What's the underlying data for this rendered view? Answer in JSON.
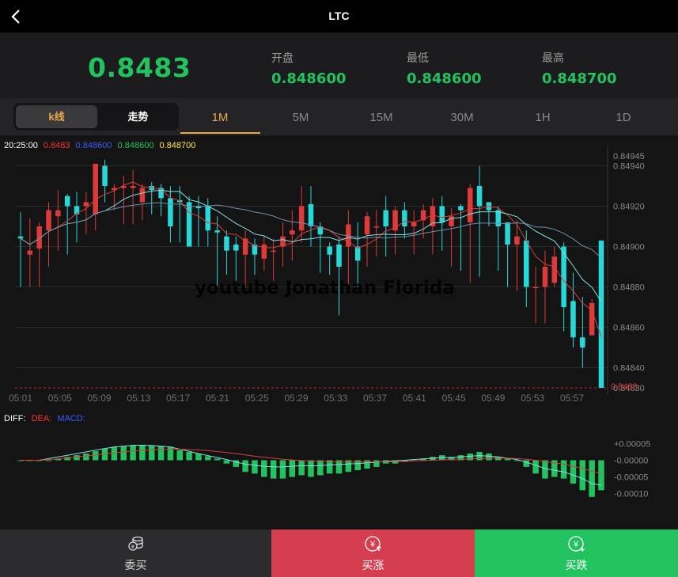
{
  "header": {
    "title": "LTC"
  },
  "quote": {
    "price": "0.8483",
    "open_label": "开盘",
    "open_value": "0.848600",
    "low_label": "最低",
    "low_value": "0.848600",
    "high_label": "最高",
    "high_value": "0.848700"
  },
  "toggle": {
    "kline": "k线",
    "trend": "走势"
  },
  "timeframes": [
    "1M",
    "5M",
    "15M",
    "30M",
    "1H",
    "1D"
  ],
  "active_timeframe": "1M",
  "ma_line": {
    "time": "20:25:00",
    "v1": "0.8483",
    "v2": "0.848600",
    "v3": "0.848600",
    "v4": "0.848700"
  },
  "watermark": "youtube Jonathan Florida",
  "macd_labels": {
    "diff": "DIFF:",
    "dea": "DEA:",
    "macd": "MACD:"
  },
  "colors": {
    "up": "#dd3b3b",
    "down": "#26d8d8",
    "green": "#22c35e",
    "accent": "#e8a94a"
  },
  "buttons": {
    "entrust": "委买",
    "buy_up": "买涨",
    "buy_down": "买跌"
  },
  "chart_data": [
    {
      "type": "candlestick",
      "y_ticks": [
        "0.84945",
        "0.84940",
        "0.84920",
        "0.84900",
        "0.84880",
        "0.84860",
        "0.84840",
        "0.84830"
      ],
      "ylim": [
        0.8483,
        0.8495
      ],
      "current_label": "0.8483",
      "x_ticks": [
        "05:01",
        "05:05",
        "05:09",
        "05:13",
        "05:17",
        "05:21",
        "05:25",
        "05:29",
        "05:33",
        "05:37",
        "05:41",
        "05:45",
        "05:49",
        "05:53",
        "05:57"
      ],
      "candles": [
        [
          0.84905,
          0.84904,
          0.84917,
          0.8488
        ],
        [
          0.84896,
          0.84898,
          0.84914,
          0.8488
        ],
        [
          0.84899,
          0.8491,
          0.84912,
          0.8488
        ],
        [
          0.84908,
          0.84918,
          0.84922,
          0.8489
        ],
        [
          0.84915,
          0.84918,
          0.84928,
          0.84898
        ],
        [
          0.84925,
          0.8492,
          0.84926,
          0.84896
        ],
        [
          0.8492,
          0.84916,
          0.84927,
          0.84902
        ],
        [
          0.8492,
          0.84922,
          0.84927,
          0.84906
        ],
        [
          0.84916,
          0.84941,
          0.84941,
          0.84908
        ],
        [
          0.8494,
          0.8493,
          0.84943,
          0.84922
        ],
        [
          0.84928,
          0.84929,
          0.84931,
          0.84918
        ],
        [
          0.84929,
          0.8493,
          0.84935,
          0.84911
        ],
        [
          0.84929,
          0.8493,
          0.84938,
          0.84911
        ],
        [
          0.84922,
          0.84929,
          0.84931,
          0.84913
        ],
        [
          0.8493,
          0.84928,
          0.84932,
          0.84916
        ],
        [
          0.84929,
          0.84924,
          0.84931,
          0.84915
        ],
        [
          0.84924,
          0.8491,
          0.8493,
          0.84902
        ],
        [
          0.84923,
          0.84922,
          0.8493,
          0.84902
        ],
        [
          0.84922,
          0.849,
          0.84925,
          0.849
        ],
        [
          0.8492,
          0.84919,
          0.84925,
          0.849
        ],
        [
          0.8492,
          0.84908,
          0.84924,
          0.849
        ],
        [
          0.84908,
          0.84907,
          0.84915,
          0.8488
        ],
        [
          0.84905,
          0.84898,
          0.84908,
          0.84886
        ],
        [
          0.84901,
          0.84898,
          0.84905,
          0.8488
        ],
        [
          0.84896,
          0.84904,
          0.84908,
          0.8488
        ],
        [
          0.84901,
          0.84896,
          0.84904,
          0.84886
        ],
        [
          0.84894,
          0.84901,
          0.84905,
          0.84888
        ],
        [
          0.84898,
          0.84898,
          0.84904,
          0.84883
        ],
        [
          0.849,
          0.84905,
          0.84912,
          0.8489
        ],
        [
          0.84906,
          0.84908,
          0.84918,
          0.84893
        ],
        [
          0.84908,
          0.8492,
          0.8493,
          0.84902
        ],
        [
          0.84921,
          0.8491,
          0.8493,
          0.849
        ],
        [
          0.8491,
          0.84906,
          0.84912,
          0.84887
        ],
        [
          0.849,
          0.84896,
          0.84902,
          0.84886
        ],
        [
          0.84901,
          0.8489,
          0.84905,
          0.84866
        ],
        [
          0.849,
          0.84911,
          0.84918,
          0.8488
        ],
        [
          0.849,
          0.84893,
          0.84912,
          0.8488
        ],
        [
          0.84906,
          0.84915,
          0.84917,
          0.8489
        ],
        [
          0.8491,
          0.8491,
          0.84918,
          0.84895
        ],
        [
          0.84918,
          0.8491,
          0.84925,
          0.84895
        ],
        [
          0.84908,
          0.84918,
          0.8492,
          0.84896
        ],
        [
          0.84918,
          0.8491,
          0.84922,
          0.84904
        ],
        [
          0.8491,
          0.84912,
          0.84918,
          0.84896
        ],
        [
          0.84913,
          0.84918,
          0.84921,
          0.84904
        ],
        [
          0.8491,
          0.8492,
          0.84924,
          0.84896
        ],
        [
          0.8492,
          0.84912,
          0.84925,
          0.84898
        ],
        [
          0.8491,
          0.84915,
          0.84919,
          0.8489
        ],
        [
          0.8492,
          0.84918,
          0.84921,
          0.84888
        ],
        [
          0.84912,
          0.84929,
          0.84931,
          0.84882
        ],
        [
          0.8493,
          0.8492,
          0.8494,
          0.84885
        ],
        [
          0.84922,
          0.84918,
          0.84922,
          0.8491
        ],
        [
          0.84918,
          0.8491,
          0.8492,
          0.84888
        ],
        [
          0.84912,
          0.84901,
          0.84912,
          0.8488
        ],
        [
          0.84901,
          0.84905,
          0.84913,
          0.84878
        ],
        [
          0.84903,
          0.8488,
          0.84908,
          0.8487
        ],
        [
          0.8488,
          0.8488,
          0.8489,
          0.84862
        ],
        [
          0.8488,
          0.8489,
          0.84898,
          0.84862
        ],
        [
          0.84882,
          0.84895,
          0.849,
          0.8488
        ],
        [
          0.849,
          0.8487,
          0.84902,
          0.84858
        ],
        [
          0.84873,
          0.84855,
          0.84887,
          0.8485
        ],
        [
          0.84855,
          0.8485,
          0.84875,
          0.8484
        ],
        [
          0.84856,
          0.84872,
          0.84874,
          0.84858
        ],
        [
          0.84903,
          0.8483,
          0.84903,
          0.8483
        ]
      ],
      "ma_series": [
        {
          "color": "#dd3b3b",
          "period": 5
        },
        {
          "color": "#7fe0e0",
          "period": 10
        },
        {
          "color": "#6f8fa8",
          "period": 20
        }
      ]
    },
    {
      "type": "bar",
      "y_ticks": [
        "+0.00005",
        "-0.00000",
        "-0.00005",
        "-0.00010"
      ],
      "ylim": [
        -0.00012,
        7e-05
      ],
      "macd": [
        0,
        0,
        0,
        0,
        5e-06,
        1e-05,
        1.5e-05,
        2e-05,
        2.7e-05,
        3.5e-05,
        4e-05,
        4.2e-05,
        4.5e-05,
        4.5e-05,
        4.4e-05,
        4.2e-05,
        4e-05,
        3e-05,
        2.5e-05,
        2e-05,
        1.2e-05,
        5e-06,
        -1e-05,
        -2e-05,
        -3.5e-05,
        -4e-05,
        -5e-05,
        -5.5e-05,
        -5.5e-05,
        -5e-05,
        -4.5e-05,
        -5e-05,
        -4.5e-05,
        -4e-05,
        -4e-05,
        -3.5e-05,
        -3e-05,
        -2.5e-05,
        -2e-05,
        -1e-05,
        -1e-05,
        -5e-06,
        0,
        5e-06,
        1e-05,
        1.5e-05,
        1e-05,
        1.5e-05,
        2e-05,
        2.5e-05,
        2e-05,
        1e-05,
        5e-06,
        0,
        -2e-05,
        -4e-05,
        -5.5e-05,
        -5e-05,
        -5.5e-05,
        -7e-05,
        -9e-05,
        -0.00011,
        -9e-05
      ],
      "diff": [
        0,
        0,
        0,
        5e-06,
        1e-05,
        1.5e-05,
        2e-05,
        2.5e-05,
        3e-05,
        3.5e-05,
        4e-05,
        4.2e-05,
        4.5e-05,
        4.5e-05,
        4.4e-05,
        4.2e-05,
        4e-05,
        3.3e-05,
        2.7e-05,
        2e-05,
        1.4e-05,
        8e-06,
        2e-06,
        -5e-06,
        -1.2e-05,
        -1.5e-05,
        -1.8e-05,
        -2e-05,
        -2e-05,
        -1.8e-05,
        -1.6e-05,
        -1.7e-05,
        -1.6e-05,
        -1.4e-05,
        -1.3e-05,
        -1.1e-05,
        -1e-05,
        -8e-06,
        -6e-06,
        -3e-06,
        -2e-06,
        0,
        2e-06,
        4e-06,
        6e-06,
        8e-06,
        8e-06,
        1e-05,
        1.2e-05,
        1.4e-05,
        1.2e-05,
        1e-05,
        6e-06,
        2e-06,
        -6e-06,
        -1.5e-05,
        -2.5e-05,
        -3e-05,
        -3.5e-05,
        -4.5e-05,
        -5.5e-05,
        -7e-05,
        -7.5e-05
      ],
      "dea": [
        0,
        0,
        0,
        2e-06,
        4e-06,
        7e-06,
        1e-05,
        1.3e-05,
        1.6e-05,
        1.9e-05,
        2.2e-05,
        2.5e-05,
        2.8e-05,
        3e-05,
        3.1e-05,
        3.2e-05,
        3.3e-05,
        3.3e-05,
        3.2e-05,
        3.1e-05,
        2.9e-05,
        2.6e-05,
        2.3e-05,
        2e-05,
        1.6e-05,
        1.2e-05,
        9e-06,
        6e-06,
        3e-06,
        1e-06,
        -1e-06,
        -2e-06,
        -3e-06,
        -4e-06,
        -5e-06,
        -5e-06,
        -5e-06,
        -5e-06,
        -5e-06,
        -4e-06,
        -4e-06,
        -3e-06,
        -2e-06,
        -1e-06,
        0,
        1e-06,
        2e-06,
        3e-06,
        4e-06,
        5e-06,
        6e-06,
        6e-06,
        6e-06,
        5e-06,
        3e-06,
        0,
        -4e-06,
        -8e-06,
        -1.2e-05,
        -1.8e-05,
        -2.5e-05,
        -3.3e-05,
        -4e-05
      ]
    }
  ]
}
